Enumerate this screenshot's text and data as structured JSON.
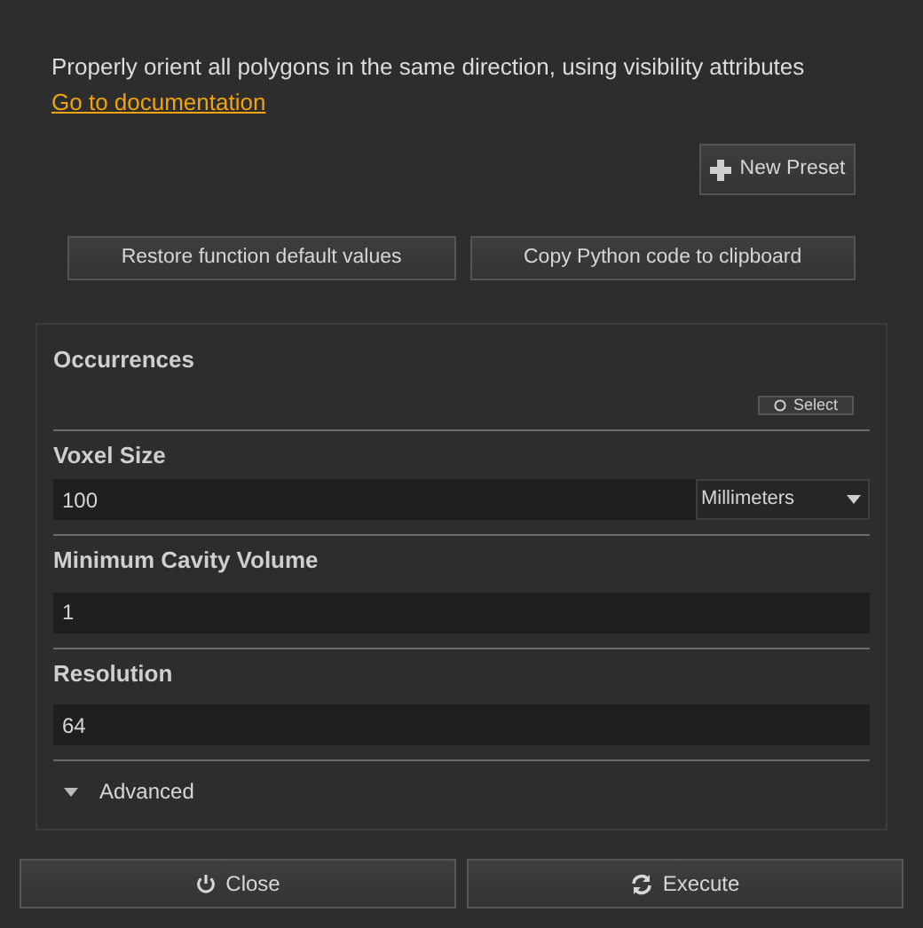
{
  "description": "Properly orient all polygons in the same direction, using visibility attributes",
  "documentation_link": "Go to documentation",
  "new_preset_button": "New Preset",
  "restore_button": "Restore function default values",
  "copy_button": "Copy Python code to clipboard",
  "parameters": [
    {
      "kind": "selection",
      "label": "Occurrences",
      "button": "Select"
    },
    {
      "kind": "number-unit",
      "label": "Voxel Size",
      "value": "100",
      "unit": "Millimeters"
    },
    {
      "kind": "number",
      "label": "Minimum Cavity Volume",
      "value": "1"
    },
    {
      "kind": "number",
      "label": "Resolution",
      "value": "64"
    }
  ],
  "advanced": {
    "label": "Advanced",
    "expanded": false
  },
  "close_button": "Close",
  "execute_button": "Execute"
}
